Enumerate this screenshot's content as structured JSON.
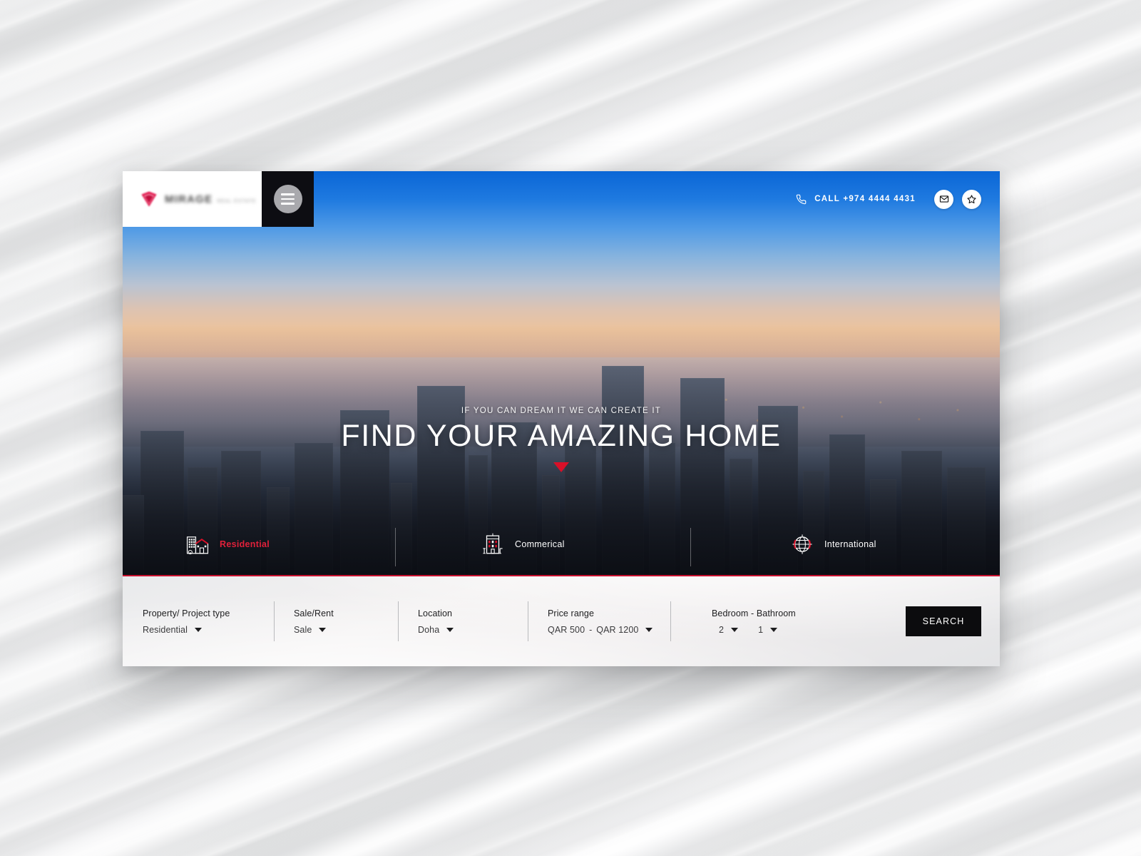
{
  "brand": {
    "logo_word": "MIRAGE",
    "logo_sub": "REAL ESTATE",
    "accent_red": "#c8102e",
    "dark": "#0c0c0e"
  },
  "header": {
    "menu_icon": "hamburger-menu-icon",
    "phone_icon": "phone-icon",
    "call_label": "CALL +974 4444 4431",
    "mail_icon": "envelope-icon",
    "favorites_icon": "star-icon"
  },
  "hero": {
    "tagline": "IF YOU CAN DREAM IT WE CAN CREATE IT",
    "headline": "FIND YOUR AMAZING HOME",
    "scroll_icon": "scroll-down-arrow-icon"
  },
  "categories": [
    {
      "label": "Residential",
      "icon": "residential-building-icon",
      "active": true
    },
    {
      "label": "Commerical",
      "icon": "commercial-building-icon",
      "active": false
    },
    {
      "label": "International",
      "icon": "globe-icon",
      "active": false
    }
  ],
  "search": {
    "fields": [
      {
        "label": "Property/ Project type",
        "value": "Residential"
      },
      {
        "label": "Sale/Rent",
        "value": "Sale"
      },
      {
        "label": "Location",
        "value": "Doha"
      },
      {
        "label": "Price range",
        "value": "QAR 500",
        "value2": "QAR 1200",
        "separator": "-"
      },
      {
        "label": "Bedroom - Bathroom",
        "value": "2",
        "value2": "1"
      }
    ],
    "button_label": "SEARCH"
  }
}
